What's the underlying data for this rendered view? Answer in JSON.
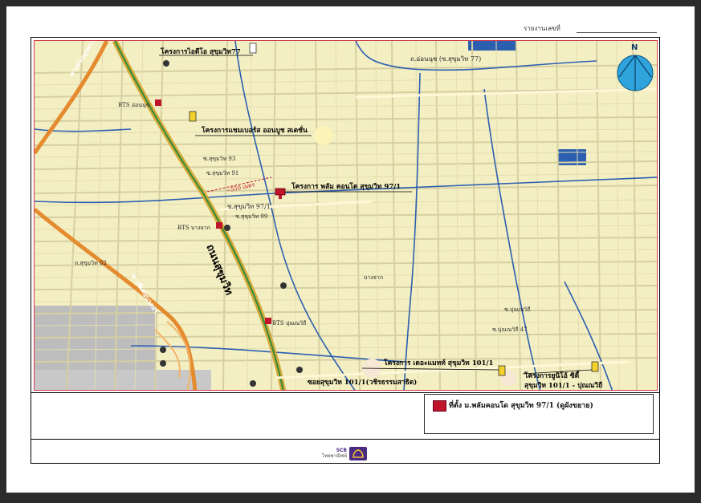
{
  "header": {
    "report_label": "รายงานเลขที่"
  },
  "map": {
    "north_label": "N",
    "projects": [
      {
        "name": "project-ideo-label",
        "text": "โครงการไอดีโอ สุขุมวิท77"
      },
      {
        "name": "project-wyne-label",
        "text": "โครงการแชมเบอร์ส ออนบูช สเตชั่น"
      },
      {
        "name": "project-subject-label",
        "text": "โครงการ พลัม คอนโด สุขุมวิท 97/1"
      },
      {
        "name": "project-the-base-label",
        "text": "โครงการ เดอะแมทท์ สุขุมวิท 101/1"
      },
      {
        "name": "project-ville-label",
        "text": "โครงการยูนิโอ้ ซิตี้"
      }
    ],
    "roads": {
      "onnut_label": "ถ.อ่อนนุช (ซ.สุขุมวิท 77)",
      "sukhumvit_label": "ถนนสุขุมวิท",
      "expressway_label": "ทางด่วนบูรพาวิถี",
      "bangna_label": "ทางพิเศษบางนา",
      "soi_97_1": "ซ.สุขุมวิท 97/1",
      "soi_101_1": "ซอยสุขุมวิท 101/1(วชิรธรรมสาธิต)",
      "soi_101_1_b": "สุขุมวิท 101/1 - ปุณณวิถี",
      "soi_93": "ซ.สุขุมวิท 93",
      "soi_91": "ซ.สุขุมวิท 91",
      "soi_62": "ถ.สุขุมวิท 62",
      "soi_99": "ซ.สุขุมวิท 99",
      "punnawithi": "ซ.ปุณณวิถี",
      "bangchak": "บางจาก",
      "soi_47": "ซ.ปุณณวิถี 47"
    },
    "stations": {
      "onnut": "BTS อ่อนนุช",
      "bangchak": "BTS บางจาก",
      "punnawithi": "BTS ปุณณวิถี"
    },
    "distance_label": "~550 เมตร"
  },
  "legend": {
    "text": "ที่ตั้ง ม.พลัมคอนโด สุขุมวิท 97/1 (ดูผังขยาย)",
    "swatch_color": "#c0142b"
  },
  "footer": {
    "logo_top": "SCB",
    "logo_bottom": "ไทยพาณิชย์"
  },
  "colors": {
    "map_background": "#f4efc2",
    "street": "#d8d1a6",
    "canal": "#2c5fb0",
    "main_road": "#d4a93a",
    "expressway": "#e48b2f",
    "bts_line": "#2f8a3a"
  }
}
